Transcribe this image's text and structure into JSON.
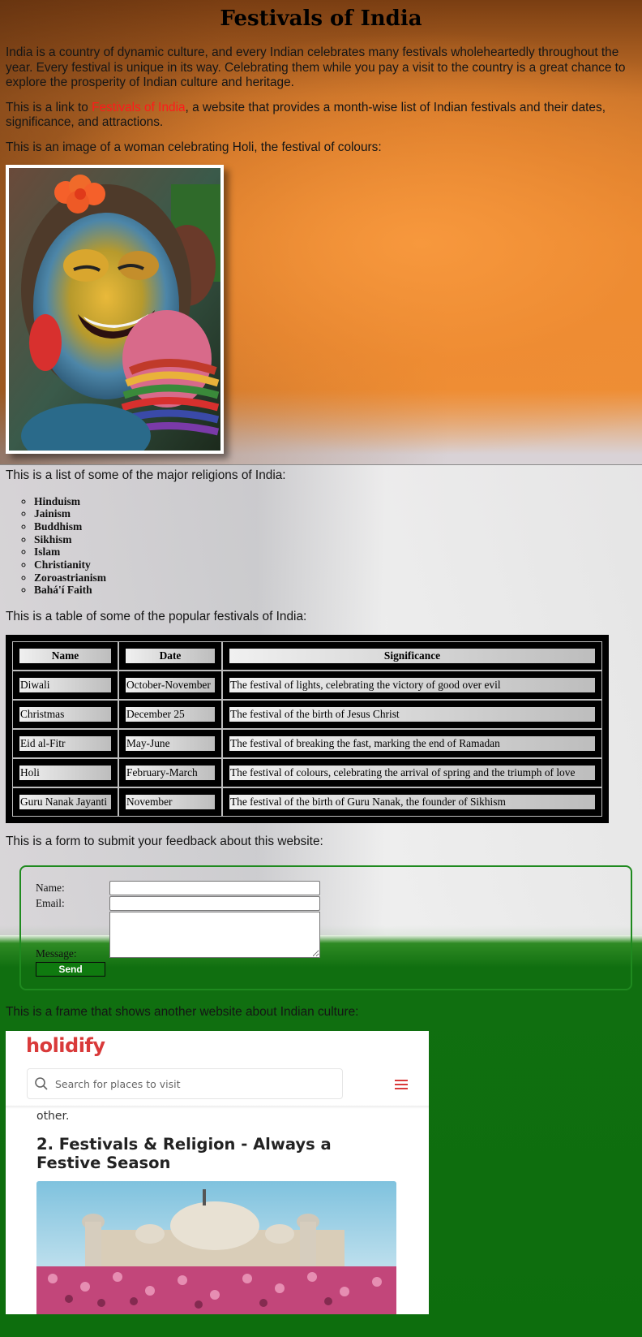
{
  "page": {
    "title": "Festivals of India",
    "intro": "India is a country of dynamic culture, and every Indian celebrates many festivals wholeheartedly throughout the year. Every festival is unique in its way. Celebrating them while you pay a visit to the country is a great chance to explore the prosperity of Indian culture and heritage.",
    "link_prefix": "This is a link to ",
    "link_text": "Festivals of India",
    "link_suffix": ", a website that provides a month-wise list of Indian festivals and their dates, significance, and attractions.",
    "image_caption": "This is an image of a woman celebrating Holi, the festival of colours:",
    "list_intro": "This is a list of some of the major religions of India:",
    "religions": [
      "Hinduism",
      "Jainism",
      "Buddhism",
      "Sikhism",
      "Islam",
      "Christianity",
      "Zoroastrianism",
      "Bahá'í Faith"
    ],
    "table_intro": "This is a table of some of the popular festivals of India:",
    "table": {
      "headers": [
        "Name",
        "Date",
        "Significance"
      ],
      "rows": [
        [
          "Diwali",
          "October-November",
          "The festival of lights, celebrating the victory of good over evil"
        ],
        [
          "Christmas",
          "December 25",
          "The festival of the birth of Jesus Christ"
        ],
        [
          "Eid al-Fitr",
          "May-June",
          "The festival of breaking the fast, marking the end of Ramadan"
        ],
        [
          "Holi",
          "February-March",
          "The festival of colours, celebrating the arrival of spring and the triumph of love"
        ],
        [
          "Guru Nanak Jayanti",
          "November",
          "The festival of the birth of Guru Nanak, the founder of Sikhism"
        ]
      ]
    },
    "form_intro": "This is a form to submit your feedback about this website:",
    "form": {
      "name_label": "Name:",
      "email_label": "Email:",
      "message_label": "Message:",
      "send_label": "Send"
    },
    "frame_intro": "This is a frame that shows another website about Indian culture:"
  },
  "iframe": {
    "logo": "holidify",
    "search_placeholder": "Search for places to visit",
    "prev_text": "other.",
    "heading": "2. Festivals & Religion - Always a Festive Season"
  },
  "colors": {
    "link": "#ff1a1a",
    "form_border": "#1f8a1f",
    "send_button": "#0f7a0f",
    "brand": "#d93a3a"
  }
}
